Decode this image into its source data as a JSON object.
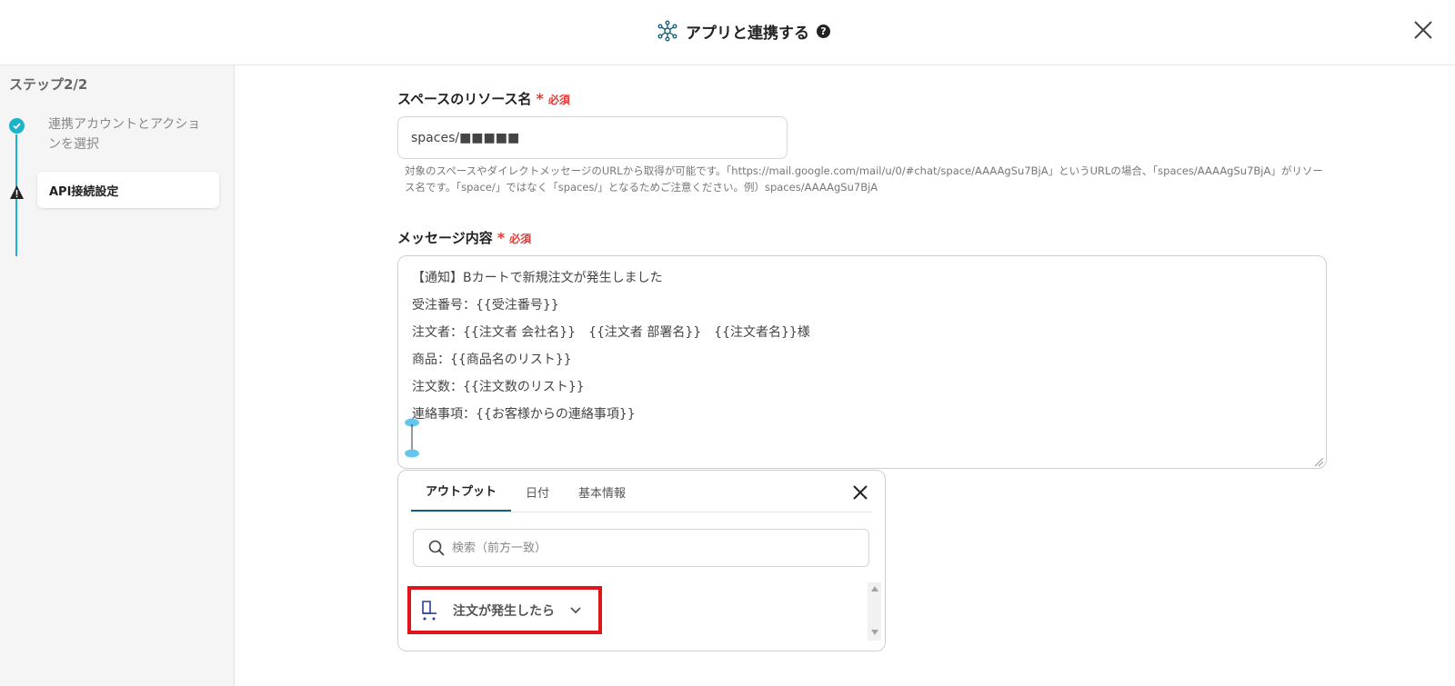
{
  "header": {
    "title": "アプリと連携する",
    "help": "?",
    "icon": "network-nodes-icon"
  },
  "sidebar": {
    "step_label": "ステップ2/2",
    "steps": [
      {
        "label": "連携アカウントとアクションを選択",
        "status": "done"
      },
      {
        "label": "API接続設定",
        "status": "warning"
      }
    ]
  },
  "main": {
    "resource": {
      "label": "スペースのリソース名",
      "required_mark": "*",
      "required_text": "必須",
      "value": "spaces/■■■■■",
      "help": "対象のスペースやダイレクトメッセージのURLから取得が可能です。「https://mail.google.com/mail/u/0/#chat/space/AAAAgSu7BjA」というURLの場合、「spaces/AAAAgSu7BjA」がリソース名です。「space/」ではなく「spaces/」となるためご注意ください。例）spaces/AAAAgSu7BjA"
    },
    "message": {
      "label": "メッセージ内容",
      "required_mark": "*",
      "required_text": "必須",
      "lines": [
        "【通知】Bカートで新規注文が発生しました",
        "受注番号：{{受注番号}}",
        "注文者：{{注文者 会社名}}　{{注文者 部署名}}　{{注文者名}}様",
        "商品：{{商品名のリスト}}",
        "注文数：{{注文数のリスト}}",
        "連絡事項：{{お客様からの連絡事項}}"
      ]
    }
  },
  "popup": {
    "tabs": [
      {
        "label": "アウトプット",
        "active": true
      },
      {
        "label": "日付",
        "active": false
      },
      {
        "label": "基本情報",
        "active": false
      }
    ],
    "search_placeholder": "検索（前方一致）",
    "trigger": {
      "label": "注文が発生したら"
    }
  },
  "colors": {
    "accent": "#1bb3c9",
    "required": "#e53935",
    "highlight_border": "#e1141b",
    "tab_underline": "#1a5f7a"
  }
}
